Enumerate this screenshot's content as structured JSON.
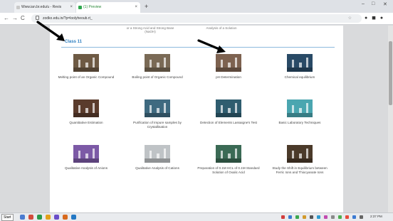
{
  "browser": {
    "tabs": [
      {
        "label": "Www.ian.br.edu/u - Revis",
        "active": false
      },
      {
        "label": "(1) Preview",
        "active": true
      }
    ],
    "new_tab": "+",
    "url": "zodko.edu.in/?p=loolyheoub.rt_",
    "nav": {
      "back": "←",
      "forward": "→",
      "reload": "C"
    },
    "window": {
      "minimize": "–",
      "maximize": "□",
      "close": "✕"
    }
  },
  "page": {
    "previous_row": [
      "or a Strong Acid and Strong Base (NaOH)",
      "Analysis of a Solution"
    ],
    "section_title": "Class 11",
    "experiments": [
      {
        "label": "Melting point of an Organic Compound",
        "icon": "melting-point-thumbnail",
        "bg": "#6e5a44"
      },
      {
        "label": "Boiling point of Organic Compound",
        "icon": "boiling-point-thumbnail",
        "bg": "#7a6a56"
      },
      {
        "label": "pH Determination",
        "icon": "ph-thumbnail",
        "bg": "#7d6250"
      },
      {
        "label": "Chemical equilibrium",
        "icon": "chemical-equilibrium-thumbnail",
        "bg": "#294a66"
      },
      {
        "label": "Quantitative Estimation",
        "icon": "quantitative-estimation-thumbnail",
        "bg": "#5a3b2c"
      },
      {
        "label": "Purification of Impure samples by Crystallisation",
        "icon": "crystallisation-thumbnail",
        "bg": "#3f6a80"
      },
      {
        "label": "Detection of Elements Lassaigne's Test",
        "icon": "lassaigne-test-thumbnail",
        "bg": "#2f5d6f"
      },
      {
        "label": "Basic Laboratory Techniques",
        "icon": "lab-techniques-thumbnail",
        "bg": "#4aa6b0"
      },
      {
        "label": "Qualitative Analysis of Anions",
        "icon": "anions-thumbnail",
        "bg": "#7c5aa6"
      },
      {
        "label": "Qualitative Analysis of Cations",
        "icon": "cations-thumbnail",
        "bg": "#bfc3c6"
      },
      {
        "label": "Preparation of 0.1M HCL of 0.1M Standard Solution of Oxalic Acid",
        "icon": "oxalic-acid-thumbnail",
        "bg": "#3b6a55"
      },
      {
        "label": "Study the Shift in Equilibrium between Ferric Ions and Thiocyanate Ions",
        "icon": "equilibrium-shift-thumbnail",
        "bg": "#4b3a2a"
      }
    ]
  },
  "taskbar": {
    "start": "Start",
    "tray_time": "2:37 PM"
  }
}
